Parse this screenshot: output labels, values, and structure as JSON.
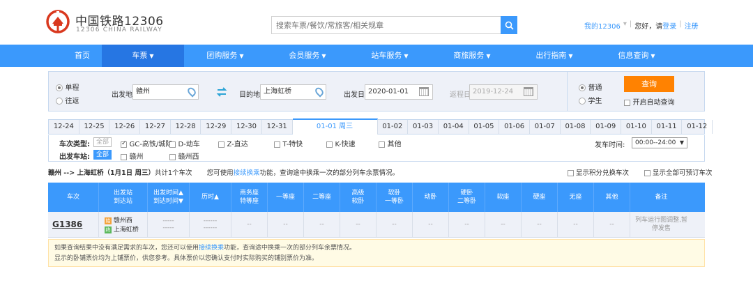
{
  "header": {
    "logo_cn": "中国铁路12306",
    "logo_en": "12306 CHINA RAILWAY",
    "search_placeholder": "搜索车票/餐饮/常旅客/相关规章",
    "my_account": "我的12306",
    "greeting": "您好，请",
    "login": "登录",
    "register": "注册"
  },
  "nav": [
    "首页",
    "车票",
    "团购服务",
    "会员服务",
    "站车服务",
    "商旅服务",
    "出行指南",
    "信息查询"
  ],
  "nav_dropdown": [
    false,
    true,
    true,
    true,
    true,
    true,
    true,
    true
  ],
  "query": {
    "trip_oneway": "单程",
    "trip_round": "往返",
    "from_label": "出发地",
    "from_value": "赣州",
    "to_label": "目的地",
    "to_value": "上海虹桥",
    "depart_label": "出发日",
    "depart_value": "2020-01-01",
    "return_label": "返程日",
    "return_value": "2019-12-24",
    "type_normal": "普通",
    "type_student": "学生",
    "query_button": "查询",
    "auto_query": "开启自动查询"
  },
  "dates": [
    "12-24",
    "12-25",
    "12-26",
    "12-27",
    "12-28",
    "12-29",
    "12-30",
    "12-31",
    "01-01 周三",
    "01-02",
    "01-03",
    "01-04",
    "01-05",
    "01-06",
    "01-07",
    "01-08",
    "01-09",
    "01-10",
    "01-11",
    "01-12"
  ],
  "filters": {
    "train_type_label": "车次类型:",
    "all": "全部",
    "types": [
      "GC-高铁/城际",
      "D-动车",
      "Z-直达",
      "T-特快",
      "K-快速",
      "其他"
    ],
    "station_label": "出发车站:",
    "stations": [
      "赣州",
      "赣州西"
    ],
    "time_label": "发车时间:",
    "time_value": "00:00--24:00"
  },
  "summary": {
    "route": "赣州 --> 上海虹桥（1月1日 周三）",
    "count": "共计1个车次",
    "tip_pre": "您可使用",
    "tip_link": "接续换乘",
    "tip_post": "功能，查询途中换乘一次的部分列车余票情况。",
    "points_train": "显示积分兑换车次",
    "all_bookable": "显示全部可预订车次"
  },
  "table": {
    "headers": [
      "车次",
      "出发站\n到达站",
      "出发时间▲\n到达时间▼",
      "历时▲",
      "商务座\n特等座",
      "一等座",
      "二等座",
      "高级\n软卧",
      "软卧\n一等卧",
      "动卧",
      "硬卧\n二等卧",
      "软座",
      "硬座",
      "无座",
      "其他",
      "备注"
    ],
    "row": {
      "train": "G1386",
      "from_badge": "始",
      "from_station": "赣州西",
      "to_badge": "终",
      "to_station": "上海虹桥",
      "dep_time": "-----",
      "arr_time": "-----",
      "dur1": "------",
      "dur2": "------",
      "seat": "--",
      "remark": "列车运行图调整,暂停发售"
    }
  },
  "notice": {
    "line1_pre": "如果查询结果中没有满足需求的车次，您还可以使用",
    "line1_link": "接续换乘",
    "line1_post": "功能，查询途中换乘一次的部分列车余票情况。",
    "line2": "显示的卧铺票价均为上铺票价，供您参考。具体票价以您确认支付时实际购买的铺别票价为准。"
  },
  "colors": {
    "primary": "#3b99fc",
    "nav_active": "#2676e3",
    "query_button": "#ff8201",
    "logo": "#d9381e"
  }
}
